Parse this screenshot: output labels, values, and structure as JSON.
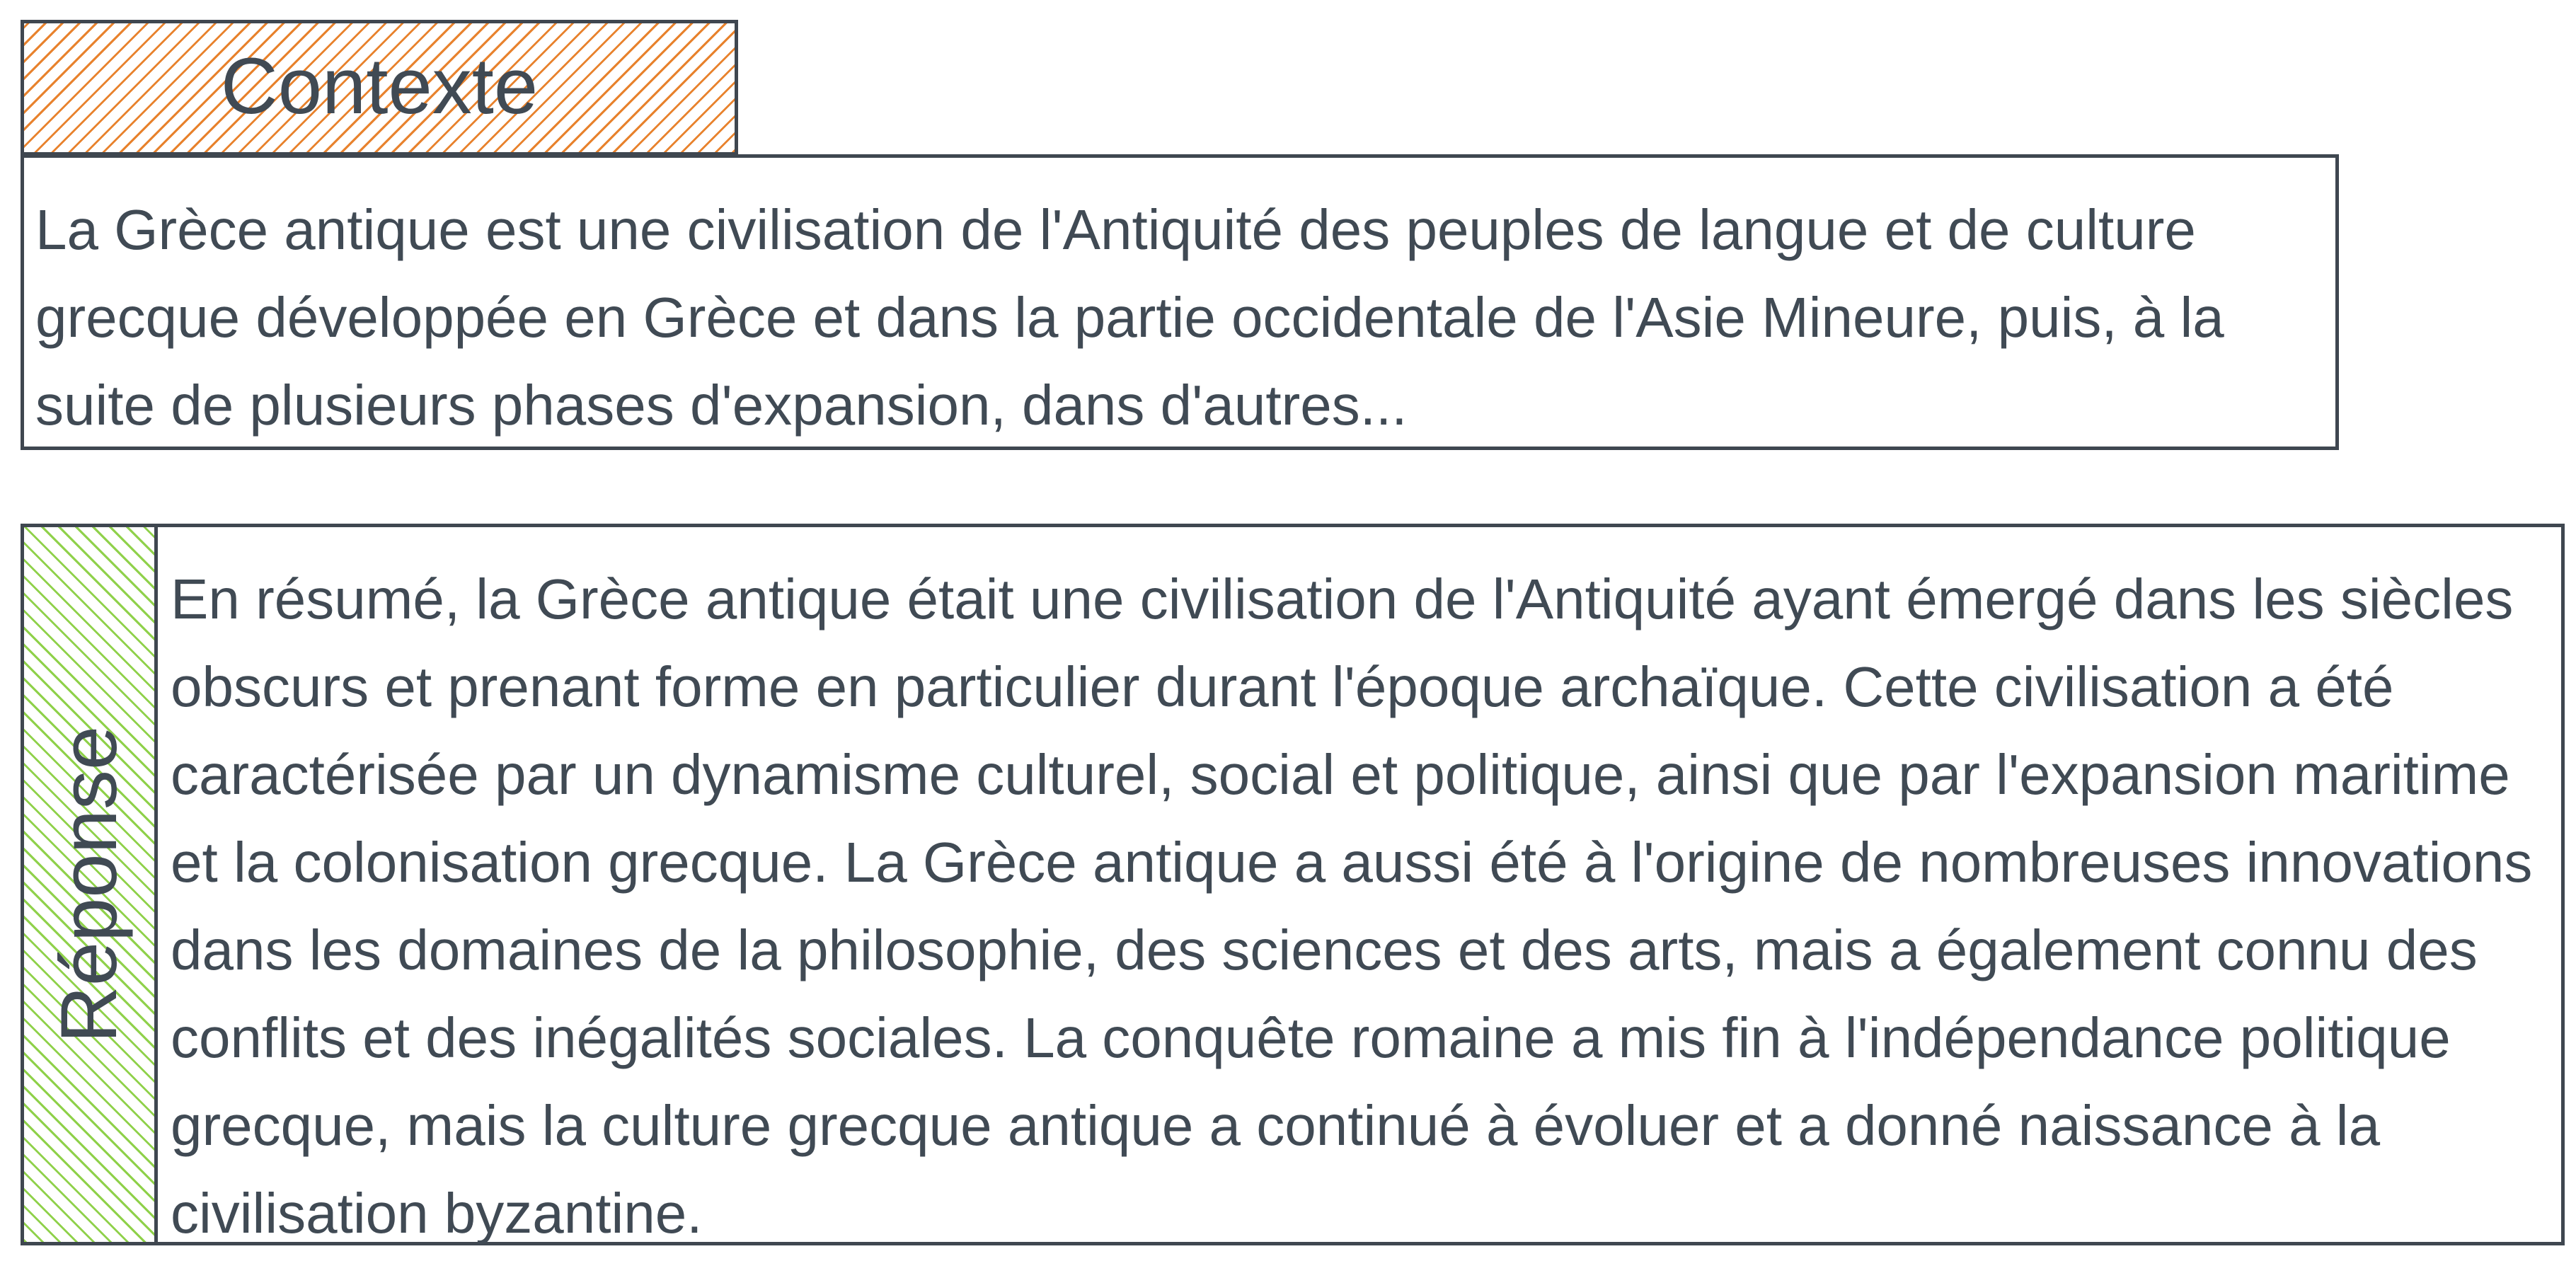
{
  "context": {
    "label": "Contexte",
    "text": "La Grèce antique est une civilisation de l'Antiquité des peuples de langue et de culture grecque développée en Grèce et dans la partie occidentale de l'Asie Mineure, puis, à la suite de plusieurs phases d'expansion, dans d'autres...",
    "hatch_color": "#e8822d"
  },
  "response": {
    "label": "Réponse",
    "text": "En résumé, la Grèce antique était une civilisation de l'Antiquité ayant émergé dans les siècles obscurs et prenant forme en particulier durant l'époque archaïque. Cette civilisation a été caractérisée par un dynamisme culturel, social et politique, ainsi que par l'expansion maritime et la colonisation grecque. La Grèce antique a aussi été à l'origine de nombreuses innovations dans les domaines de la philosophie, des sciences et des arts, mais a également connu des conflits et des inégalités sociales. La conquête romaine a mis fin à l'indépendance politique grecque, mais la culture grecque antique a continué à évoluer et a donné naissance à la civilisation byzantine.",
    "hatch_color": "#8fd14a"
  },
  "colors": {
    "border": "#3f4750",
    "text": "#404a54",
    "background": "#ffffff"
  }
}
